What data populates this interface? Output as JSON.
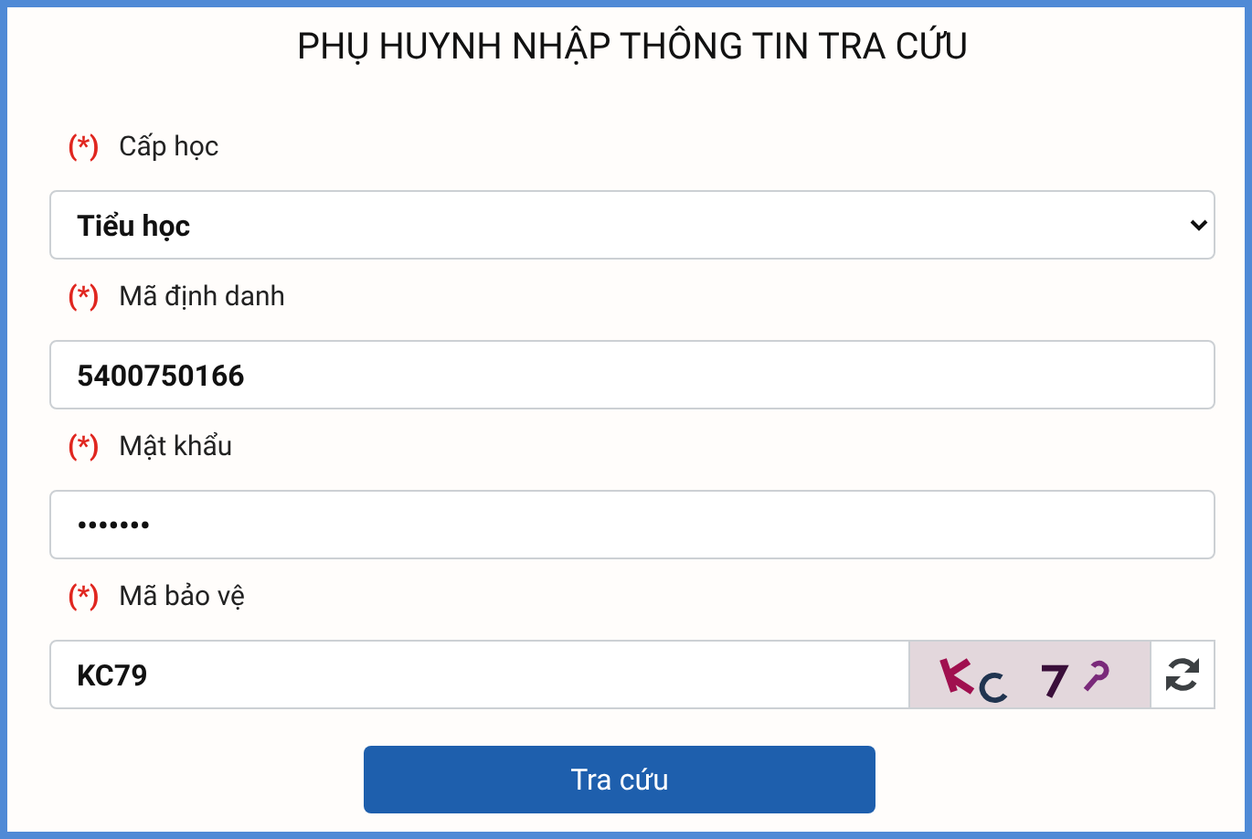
{
  "title": "PHỤ HUYNH NHẬP THÔNG TIN TRA CỨU",
  "fields": [
    {
      "kind": "select",
      "required_mark": "(*)",
      "label": "Cấp học",
      "value": "Tiểu học"
    },
    {
      "kind": "text",
      "required_mark": "(*)",
      "label": "Mã định danh",
      "value": "5400750166"
    },
    {
      "kind": "text",
      "required_mark": "(*)",
      "label": "Mật khẩu",
      "value": "•••••••"
    },
    {
      "kind": "captcha",
      "required_mark": "(*)",
      "label": "Mã bảo vệ",
      "value": "KC79"
    }
  ],
  "submit_button": "Tra cứu"
}
